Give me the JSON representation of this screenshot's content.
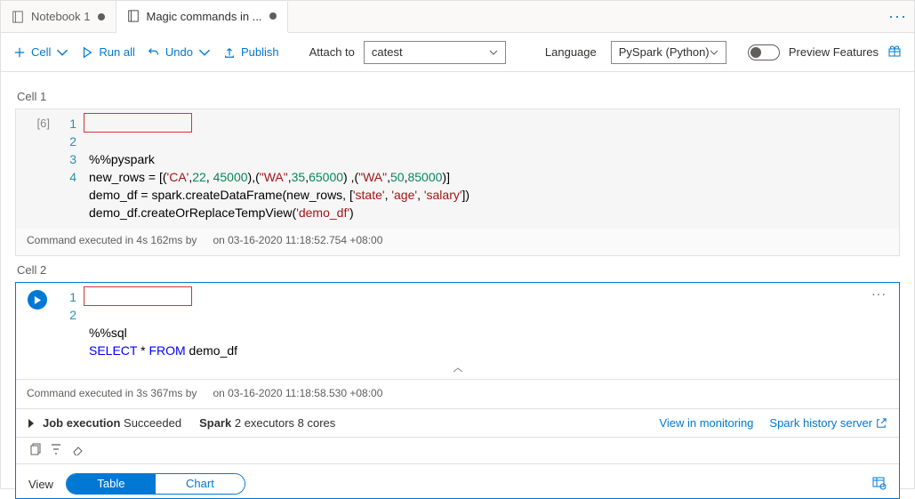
{
  "tabs": {
    "inactive": "Notebook 1",
    "active": "Magic commands in ..."
  },
  "toolbar": {
    "cell": "Cell",
    "run_all": "Run all",
    "undo": "Undo",
    "publish": "Publish",
    "attach_to_label": "Attach to",
    "attach_to_value": "catest",
    "language_label": "Language",
    "language_value": "PySpark (Python)",
    "preview": "Preview Features"
  },
  "cell1": {
    "label": "Cell 1",
    "exec_count": "[6]",
    "lines": {
      "l1": "%%pyspark",
      "l2_pre": "new_rows = [(",
      "l2_s1": "'CA'",
      "l2_c1": ",",
      "l2_n1": "22",
      "l2_c2": ", ",
      "l2_n2": "45000",
      "l2_mid": "),(",
      "l2_s2": "\"WA\"",
      "l2_c3": ",",
      "l2_n3": "35",
      "l2_c4": ",",
      "l2_n4": "65000",
      "l2_mid2": ") ,(",
      "l2_s3": "\"WA\"",
      "l2_c5": ",",
      "l2_n5": "50",
      "l2_c6": ",",
      "l2_n6": "85000",
      "l2_end": ")]",
      "l3_pre": "demo_df = spark.createDataFrame(new_rows, [",
      "l3_s1": "'state'",
      "l3_c1": ", ",
      "l3_s2": "'age'",
      "l3_c2": ", ",
      "l3_s3": "'salary'",
      "l3_end": "])",
      "l4_pre": "demo_df.createOrReplaceTempView(",
      "l4_s1": "'demo_df'",
      "l4_end": ")"
    },
    "status": "Command executed in 4s 162ms by",
    "status_ts": "on 03-16-2020 11:18:52.754 +08:00"
  },
  "cell2": {
    "label": "Cell 2",
    "lines": {
      "l1": "%%sql",
      "l2_kw": "SELECT",
      "l2_mid": " * ",
      "l2_kw2": "FROM",
      "l2_tbl": " demo_df"
    },
    "status": "Command executed in 3s 367ms by",
    "status_ts": "on 03-16-2020 11:18:58.530 +08:00",
    "job_label": "Job execution",
    "job_status": " Succeeded",
    "spark_label": "Spark",
    "spark_detail": " 2 executors 8 cores",
    "link_monitor": "View in monitoring",
    "link_history": "Spark history server",
    "view_label": "View",
    "seg_table": "Table",
    "seg_chart": "Chart"
  },
  "gutter": {
    "n1": "1",
    "n2": "2",
    "n3": "3",
    "n4": "4"
  }
}
